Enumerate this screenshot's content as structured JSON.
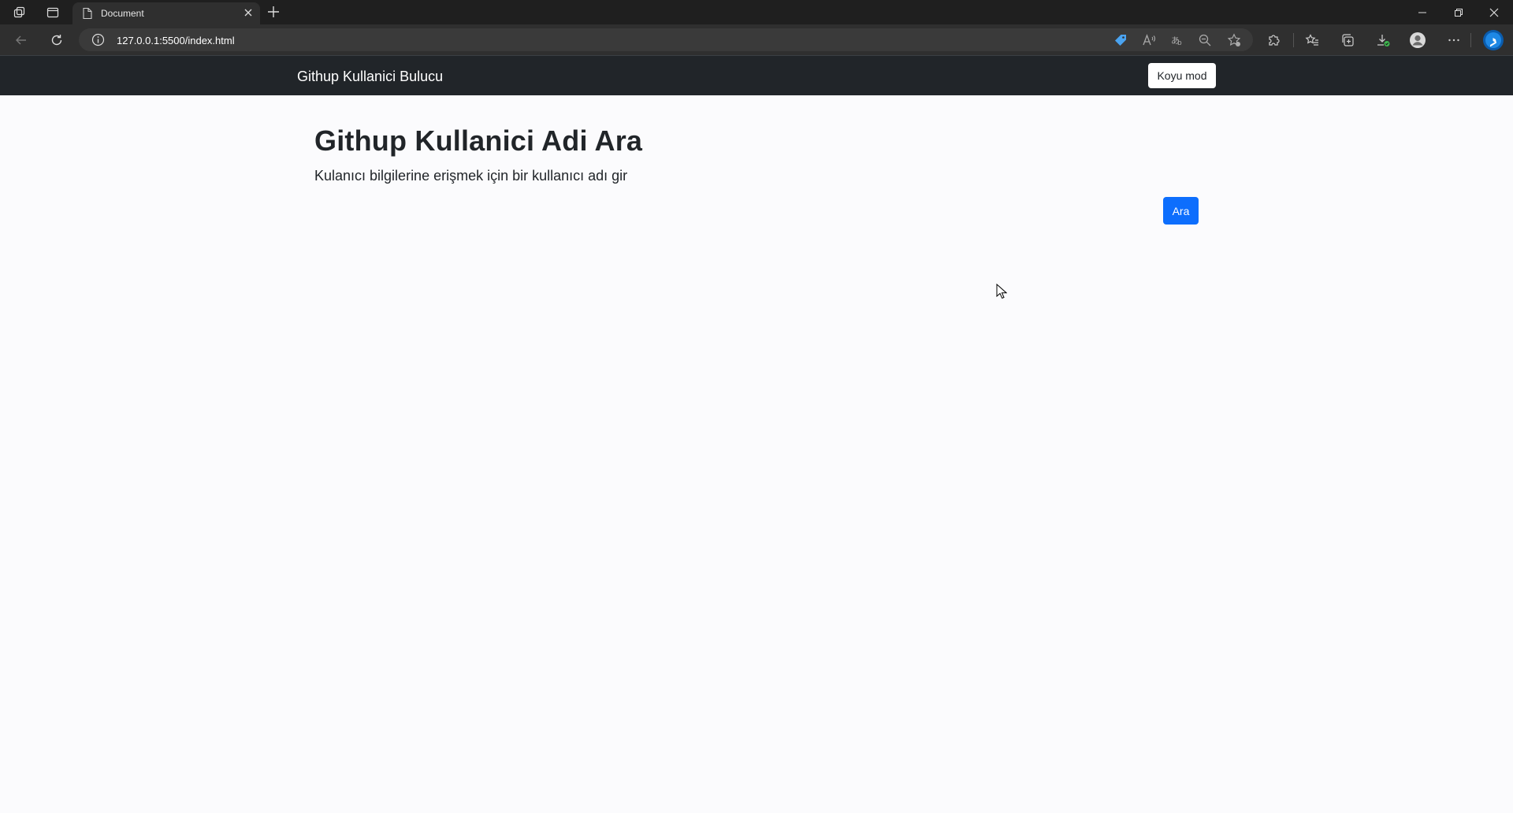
{
  "browser": {
    "tab": {
      "title": "Document"
    },
    "address": {
      "url": "127.0.0.1:5500/index.html"
    },
    "icons": {
      "workspaces": "workspaces-icon",
      "tab_actions": "tab-actions-icon",
      "page": "page-icon",
      "close_tab": "close-icon",
      "new_tab": "plus-icon",
      "back": "back-arrow-icon",
      "refresh": "refresh-icon",
      "site_info": "info-icon",
      "coupon": "tag-icon",
      "read_aloud": "read-aloud-icon",
      "translate": "translate-icon",
      "zoom": "zoom-out-icon",
      "favorite": "star-add-icon",
      "extensions": "puzzle-icon",
      "favorites": "favorites-icon",
      "collections": "collections-icon",
      "downloads": "download-icon",
      "profile": "profile-icon",
      "more": "more-icon",
      "copilot": "bing-icon"
    }
  },
  "navbar": {
    "brand": "Githup Kullanici Bulucu",
    "dark_mode_label": "Koyu mod"
  },
  "main": {
    "title": "Githup Kullanici Adi Ara",
    "lead": "Kulanıcı bilgilerine erişmek için bir kullanıcı adı gir",
    "search_button_label": "Ara"
  },
  "colors": {
    "navbar_bg": "#212529",
    "page_bg": "#fbfbfd",
    "primary": "#0d6efd"
  }
}
